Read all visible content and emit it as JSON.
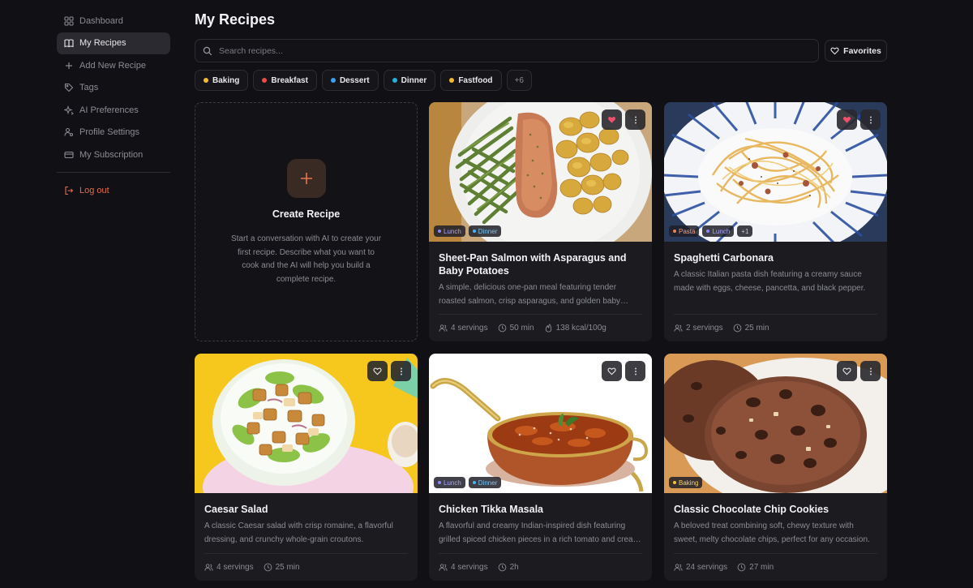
{
  "sidebar": {
    "items": [
      {
        "label": "Dashboard",
        "icon": "grid-icon"
      },
      {
        "label": "My Recipes",
        "icon": "book-icon"
      },
      {
        "label": "Add New Recipe",
        "icon": "plus-icon"
      },
      {
        "label": "Tags",
        "icon": "tag-icon"
      },
      {
        "label": "AI Preferences",
        "icon": "sparkles-icon"
      },
      {
        "label": "Profile Settings",
        "icon": "user-gear-icon"
      },
      {
        "label": "My Subscription",
        "icon": "card-icon"
      }
    ],
    "logout_label": "Log out"
  },
  "main": {
    "title": "My Recipes",
    "search_placeholder": "Search recipes...",
    "favorites_label": "Favorites",
    "filter_tags": [
      {
        "label": "Baking",
        "color": "#f5b82e"
      },
      {
        "label": "Breakfast",
        "color": "#ef4a4a"
      },
      {
        "label": "Dessert",
        "color": "#3aa0f0"
      },
      {
        "label": "Dinner",
        "color": "#27b0e0"
      },
      {
        "label": "Fastfood",
        "color": "#f5b82e"
      }
    ],
    "more_tags_label": "+6",
    "create_card": {
      "title": "Create Recipe",
      "description": "Start a conversation with AI to create your first recipe. Describe what you want to cook and the AI will help you build a complete recipe."
    },
    "recipes": [
      {
        "title": "Sheet-Pan Salmon with Asparagus and Baby Potatoes",
        "description": "A simple, delicious one-pan meal featuring tender roasted salmon, crisp asparagus, and golden baby potatoes.",
        "servings": "4 servings",
        "time": "50 min",
        "calories": "138 kcal/100g",
        "favorite": true,
        "badges": [
          {
            "label": "Lunch",
            "kind": "lunch"
          },
          {
            "label": "Dinner",
            "kind": "dinner"
          }
        ]
      },
      {
        "title": "Spaghetti Carbonara",
        "description": "A classic Italian pasta dish featuring a creamy sauce made with eggs, cheese, pancetta, and black pepper.",
        "servings": "2 servings",
        "time": "25 min",
        "favorite": true,
        "badges": [
          {
            "label": "Pasta",
            "kind": "pasta"
          },
          {
            "label": "Lunch",
            "kind": "lunch"
          },
          {
            "label": "+1",
            "kind": "more"
          }
        ]
      },
      {
        "title": "Caesar Salad",
        "description": "A classic Caesar salad with crisp romaine, a flavorful dressing, and crunchy whole-grain croutons.",
        "servings": "4 servings",
        "time": "25 min",
        "favorite": false,
        "badges": []
      },
      {
        "title": "Chicken Tikka Masala",
        "description": "A flavorful and creamy Indian-inspired dish featuring grilled spiced chicken pieces in a rich tomato and cream sauce.",
        "servings": "4 servings",
        "time": "2h",
        "favorite": false,
        "badges": [
          {
            "label": "Lunch",
            "kind": "lunch"
          },
          {
            "label": "Dinner",
            "kind": "dinner"
          }
        ]
      },
      {
        "title": "Classic Chocolate Chip Cookies",
        "description": "A beloved treat combining soft, chewy texture with sweet, melty chocolate chips, perfect for any occasion.",
        "servings": "24 servings",
        "time": "27 min",
        "favorite": false,
        "badges": [
          {
            "label": "Baking",
            "kind": "baking"
          }
        ]
      }
    ]
  },
  "colors": {
    "accent": "#e8764f",
    "heart": "#f0506e",
    "lunch": "#8b87ff",
    "dinner": "#4ab4f0",
    "pasta": "#f08050",
    "baking": "#f3c23a"
  }
}
